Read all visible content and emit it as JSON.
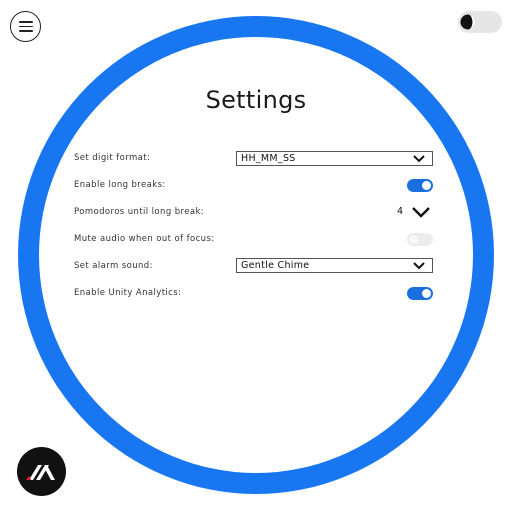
{
  "header": {
    "menu_icon": "hamburger-icon",
    "theme_icon": "half-moon-icon"
  },
  "settings": {
    "title": "Settings",
    "digit_format": {
      "label": "Set digit format:",
      "value": "HH_MM_SS"
    },
    "long_breaks": {
      "label": "Enable long breaks:",
      "enabled": true
    },
    "pomodoros": {
      "label": "Pomodoros until long break:",
      "value": "4"
    },
    "mute_audio": {
      "label": "Mute audio when out of focus:",
      "enabled": false
    },
    "alarm_sound": {
      "label": "Set alarm sound:",
      "value": "Gentle Chime"
    },
    "analytics": {
      "label": "Enable Unity Analytics:",
      "enabled": true
    }
  },
  "colors": {
    "ring": "#1877f0",
    "toggle_on": "#1a6fe0",
    "toggle_off": "#ececec"
  },
  "footer": {
    "logo_icon": "brand-logo-icon"
  }
}
